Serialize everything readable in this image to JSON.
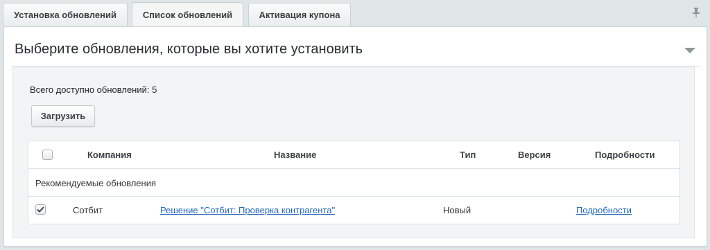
{
  "tabs": [
    {
      "label": "Установка обновлений",
      "active": false
    },
    {
      "label": "Список обновлений",
      "active": true
    },
    {
      "label": "Активация купона",
      "active": false
    }
  ],
  "section": {
    "title": "Выберите обновления, которые вы хотите установить"
  },
  "summary": {
    "total_text": "Всего доступно обновлений: 5"
  },
  "toolbar": {
    "load_label": "Загрузить"
  },
  "table": {
    "headers": {
      "company": "Компания",
      "name": "Название",
      "type": "Тип",
      "version": "Версия",
      "details": "Подробности"
    },
    "group_label": "Рекомендуемые обновления",
    "rows": [
      {
        "checked": true,
        "company": "Сотбит",
        "name": "Решение \"Сотбит: Проверка контрагента\"",
        "type": "Новый",
        "version": "",
        "details": "Подробности"
      }
    ]
  },
  "colors": {
    "background": "#e0e5e7",
    "panel": "#ffffff",
    "content_box": "#f2f4f5",
    "link": "#2266bb"
  },
  "icons": {
    "pin": "pin-icon",
    "collapse": "chevron-down-icon",
    "check": "checkmark-icon"
  }
}
